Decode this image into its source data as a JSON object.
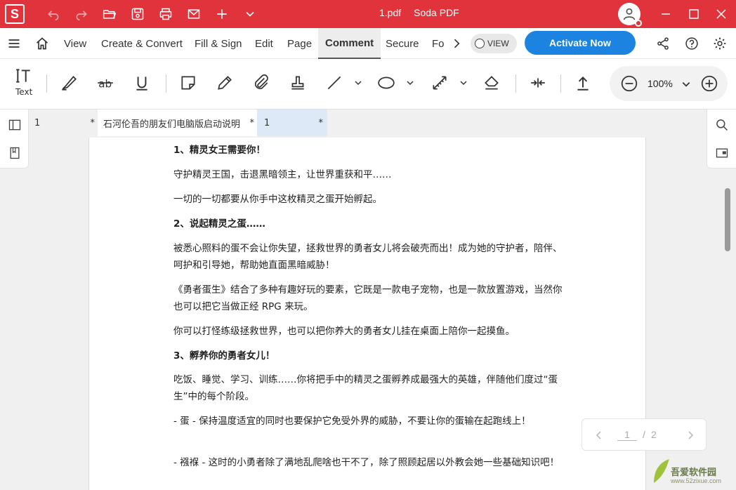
{
  "titlebar": {
    "logo": "S",
    "filename": "1.pdf",
    "app": "Soda PDF",
    "icons": [
      "undo-icon",
      "redo-icon",
      "open-folder-icon",
      "save-icon",
      "print-icon",
      "mail-icon",
      "new-tab-icon",
      "chevron-down-icon"
    ]
  },
  "menu": {
    "items": [
      "View",
      "Create & Convert",
      "Fill & Sign",
      "Edit",
      "Page",
      "Comment",
      "Secure",
      "Fo"
    ],
    "active": "Comment",
    "view_toggle": "VIEW",
    "activate": "Activate Now"
  },
  "toolbar": {
    "text_label": "Text",
    "zoom": "100%"
  },
  "tabs": [
    {
      "label": "1",
      "star": "*"
    },
    {
      "label": "石河伦吾的朋友们电脑版启动说明",
      "star": "*"
    },
    {
      "label": "1",
      "star": "*"
    }
  ],
  "document": {
    "paragraphs": [
      {
        "text": "1、精灵女王需要你！",
        "bold": true
      },
      {
        "text": "守护精灵王国，击退黑暗领主，让世界重获和平……",
        "bold": false
      },
      {
        "text": "一切的一切都要从你手中这枚精灵之蛋开始孵起。",
        "bold": false
      },
      {
        "text": "2、说起精灵之蛋……",
        "bold": true
      },
      {
        "text": "被悉心照料的蛋不会让你失望，拯救世界的勇者女儿将会破壳而出！成为她的守护者，陪伴、呵护和引导她，帮助她直面黑暗威胁！",
        "bold": false
      },
      {
        "text": "《勇者蛋生》结合了多种有趣好玩的要素，它既是一款电子宠物，也是一款放置游戏，当然你也可以把它当做正经 RPG 来玩。",
        "bold": false
      },
      {
        "text": "你可以打怪练级拯救世界，也可以把你养大的勇者女儿挂在桌面上陪你一起摸鱼。",
        "bold": false
      },
      {
        "text": "3、孵养你的勇者女儿！",
        "bold": true
      },
      {
        "text": "吃饭、睡觉、学习、训练……你将把手中的精灵之蛋孵养成最强大的英雄，伴随他们度过“蛋生”中的每个阶段。",
        "bold": false
      },
      {
        "text": "- 蛋 - 保持温度适宜的同时也要保护它免受外界的威胁，不要让你的蛋输在起跑线上！",
        "bold": false
      },
      {
        "text": "- 襁褓 - 这时的小勇者除了满地乱爬啥也干不了，除了照顾起居以外教会她一些基础知识吧！",
        "bold": false
      }
    ]
  },
  "pager": {
    "current": "1",
    "sep": "/",
    "total": "2"
  },
  "watermark": {
    "title": "吾爱软件园",
    "url": "www.52zixue.com"
  },
  "colors": {
    "brand": "#e0333c",
    "activate": "#1d83e0",
    "annotation": "#e0333c"
  }
}
